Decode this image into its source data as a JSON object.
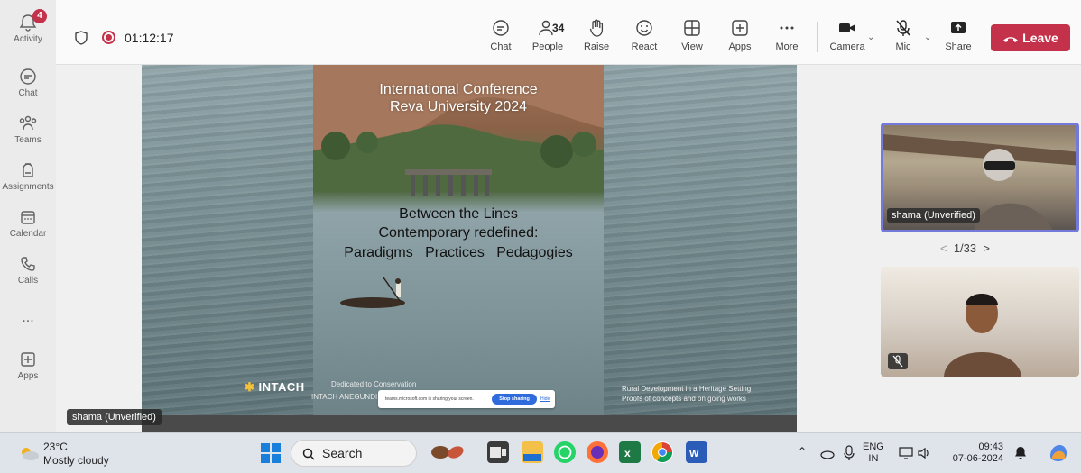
{
  "rail": {
    "activity": {
      "label": "Activity",
      "badge": "4"
    },
    "chat": {
      "label": "Chat"
    },
    "teams": {
      "label": "Teams"
    },
    "assignments": {
      "label": "Assignments"
    },
    "calendar": {
      "label": "Calendar"
    },
    "calls": {
      "label": "Calls"
    },
    "more": {
      "label": "..."
    },
    "apps": {
      "label": "Apps"
    }
  },
  "topbar": {
    "timer": "01:12:17",
    "buttons": {
      "chat": "Chat",
      "people": "People",
      "people_count": "34",
      "raise": "Raise",
      "react": "React",
      "view": "View",
      "apps": "Apps",
      "more": "More",
      "camera": "Camera",
      "mic": "Mic",
      "share": "Share",
      "leave": "Leave"
    },
    "colors": {
      "leave": "#c4314b",
      "accent": "#7479dc"
    }
  },
  "presentation": {
    "title_line1": "International Conference",
    "title_line2": "Reva University 2024",
    "sub_line1": "Between the Lines",
    "sub_line2": "Contemporary redefined:",
    "sub_line3": "Paradigms   Practices   Pedagogies",
    "intach": "INTACH",
    "dedicated": "Dedicated to Conservation",
    "intach_anegundi": "INTACH ANEGUNDI",
    "rural_line1": "Rural Development in a Heritage Setting",
    "rural_line2": "Proofs of concepts and on going works",
    "sharing_msg": "teams.microsoft.com is sharing your screen.",
    "stop_sharing": "Stop sharing",
    "hide": "Hide",
    "presenter_name": "shama (Unverified)"
  },
  "participants": {
    "video1_name": "shama (Unverified)",
    "pager": "1/33"
  },
  "taskbar": {
    "temperature": "23°C",
    "weather": "Mostly cloudy",
    "search": "Search",
    "lang1": "ENG",
    "lang2": "IN",
    "time": "09:43",
    "date": "07-06-2024"
  }
}
